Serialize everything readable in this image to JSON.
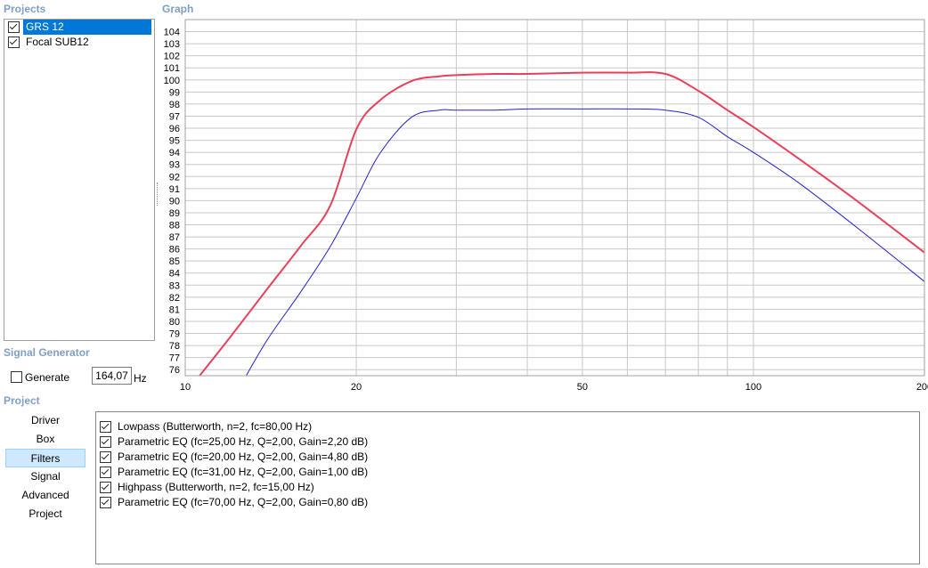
{
  "projects": {
    "title": "Projects",
    "items": [
      {
        "label": "GRS 12",
        "checked": true,
        "selected": true
      },
      {
        "label": "Focal SUB12",
        "checked": true,
        "selected": false
      }
    ]
  },
  "graph": {
    "title": "Graph"
  },
  "signal_generator": {
    "title": "Signal Generator",
    "generate_label": "Generate",
    "generate_checked": false,
    "frequency": "164,07",
    "unit": "Hz"
  },
  "project": {
    "title": "Project",
    "nav": [
      {
        "label": "Driver",
        "selected": false
      },
      {
        "label": "Box",
        "selected": false
      },
      {
        "label": "Filters",
        "selected": true
      },
      {
        "label": "Signal",
        "selected": false
      },
      {
        "label": "Advanced",
        "selected": false
      },
      {
        "label": "Project",
        "selected": false
      }
    ]
  },
  "filters": [
    {
      "label": "Lowpass (Butterworth, n=2, fc=80,00 Hz)",
      "checked": true
    },
    {
      "label": "Parametric EQ (fc=25,00 Hz, Q=2,00, Gain=2,20 dB)",
      "checked": true
    },
    {
      "label": "Parametric EQ (fc=20,00 Hz, Q=2,00, Gain=4,80 dB)",
      "checked": true
    },
    {
      "label": "Parametric EQ (fc=31,00 Hz, Q=2,00, Gain=1,00 dB)",
      "checked": true
    },
    {
      "label": "Highpass (Butterworth, n=2, fc=15,00 Hz)",
      "checked": true
    },
    {
      "label": "Parametric EQ (fc=70,00 Hz, Q=2,00, Gain=0,80 dB)",
      "checked": true
    }
  ],
  "chart_data": {
    "type": "line",
    "title": "Graph",
    "x_scale": "log",
    "xlim": [
      10,
      200
    ],
    "ylim": [
      75.5,
      105
    ],
    "x_tick_labels": [
      "10",
      "20",
      "50",
      "100",
      "200"
    ],
    "y_tick_labels": [
      "76",
      "77",
      "78",
      "79",
      "80",
      "81",
      "82",
      "83",
      "84",
      "85",
      "86",
      "87",
      "88",
      "89",
      "90",
      "91",
      "92",
      "93",
      "94",
      "95",
      "96",
      "97",
      "98",
      "99",
      "100",
      "101",
      "102",
      "103",
      "104"
    ],
    "grid": true,
    "colors": {
      "series1": "#e8405a",
      "series2": "#2222cc"
    },
    "series": [
      {
        "x": [
          10.6,
          12,
          14,
          16,
          18,
          20,
          22,
          25,
          28,
          30,
          35,
          40,
          50,
          60,
          70,
          80,
          90,
          100,
          120,
          150,
          200
        ],
        "y": [
          75.5,
          78.7,
          82.8,
          86.3,
          89.6,
          95.9,
          98.3,
          99.9,
          100.3,
          100.4,
          100.5,
          100.5,
          100.6,
          100.6,
          100.5,
          99.1,
          97.5,
          96.1,
          93.5,
          90.2,
          85.7
        ]
      },
      {
        "x": [
          12.8,
          14,
          16,
          18,
          20,
          22,
          25,
          28,
          30,
          35,
          40,
          50,
          60,
          70,
          80,
          90,
          100,
          120,
          150,
          200
        ],
        "y": [
          75.5,
          78.6,
          82.5,
          86.2,
          90.2,
          93.9,
          96.9,
          97.5,
          97.5,
          97.5,
          97.6,
          97.6,
          97.6,
          97.5,
          96.9,
          95.3,
          94.0,
          91.5,
          88.0,
          83.3
        ]
      }
    ]
  }
}
